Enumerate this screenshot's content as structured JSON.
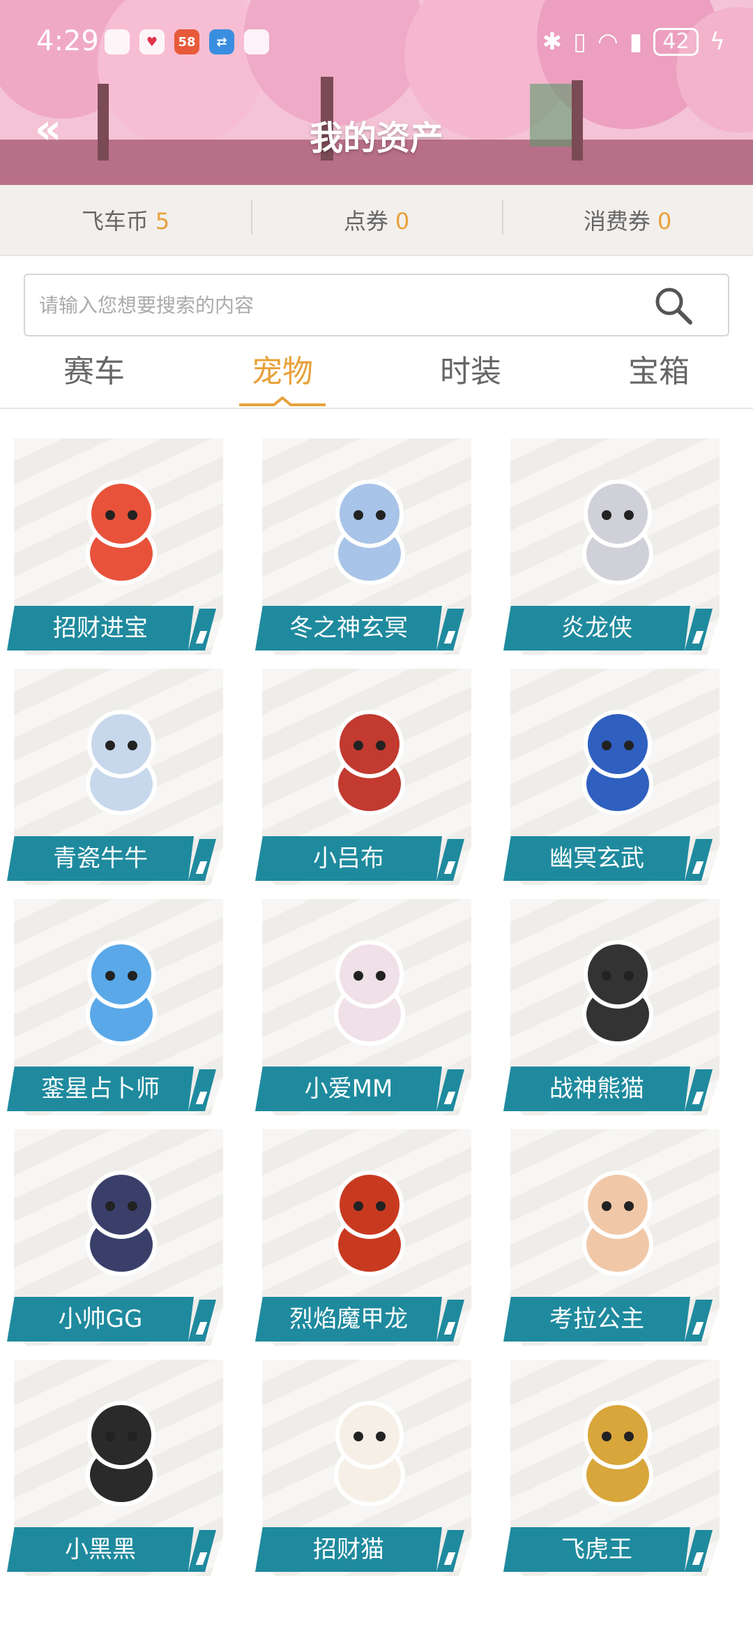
{
  "status_bar": {
    "time": "4:29",
    "battery": "42",
    "notifications": [
      "app-icon",
      "heart-icon",
      "58-app-icon",
      "transfer-icon",
      "app-icon"
    ]
  },
  "header": {
    "title": "我的资产",
    "back_icon": "double-chevron-left-icon"
  },
  "currencies": [
    {
      "label": "飞车币",
      "value": "5"
    },
    {
      "label": "点券",
      "value": "0"
    },
    {
      "label": "消费券",
      "value": "0"
    }
  ],
  "search": {
    "placeholder": "请输入您想要搜索的内容"
  },
  "tabs": [
    {
      "label": "赛车",
      "active": false
    },
    {
      "label": "宠物",
      "active": true
    },
    {
      "label": "时装",
      "active": false
    },
    {
      "label": "宝箱",
      "active": false
    }
  ],
  "pets": [
    {
      "name": "招财进宝",
      "color": "#e8523a"
    },
    {
      "name": "冬之神玄冥",
      "color": "#a8c4e8"
    },
    {
      "name": "炎龙侠",
      "color": "#d0d0d8"
    },
    {
      "name": "青瓷牛牛",
      "color": "#c8d8ec"
    },
    {
      "name": "小吕布",
      "color": "#c23a30"
    },
    {
      "name": "幽冥玄武",
      "color": "#2f5fbf"
    },
    {
      "name": "銮星占卜师",
      "color": "#5aa8e8"
    },
    {
      "name": "小爱MM",
      "color": "#f0e0e8"
    },
    {
      "name": "战神熊猫",
      "color": "#333333"
    },
    {
      "name": "小帅GG",
      "color": "#3a3f6a"
    },
    {
      "name": "烈焰魔甲龙",
      "color": "#c83a20"
    },
    {
      "name": "考拉公主",
      "color": "#f0c8a8"
    },
    {
      "name": "小黑黑",
      "color": "#2a2a2a"
    },
    {
      "name": "招财猫",
      "color": "#f6efe6"
    },
    {
      "name": "飞虎王",
      "color": "#d8a63a"
    }
  ]
}
